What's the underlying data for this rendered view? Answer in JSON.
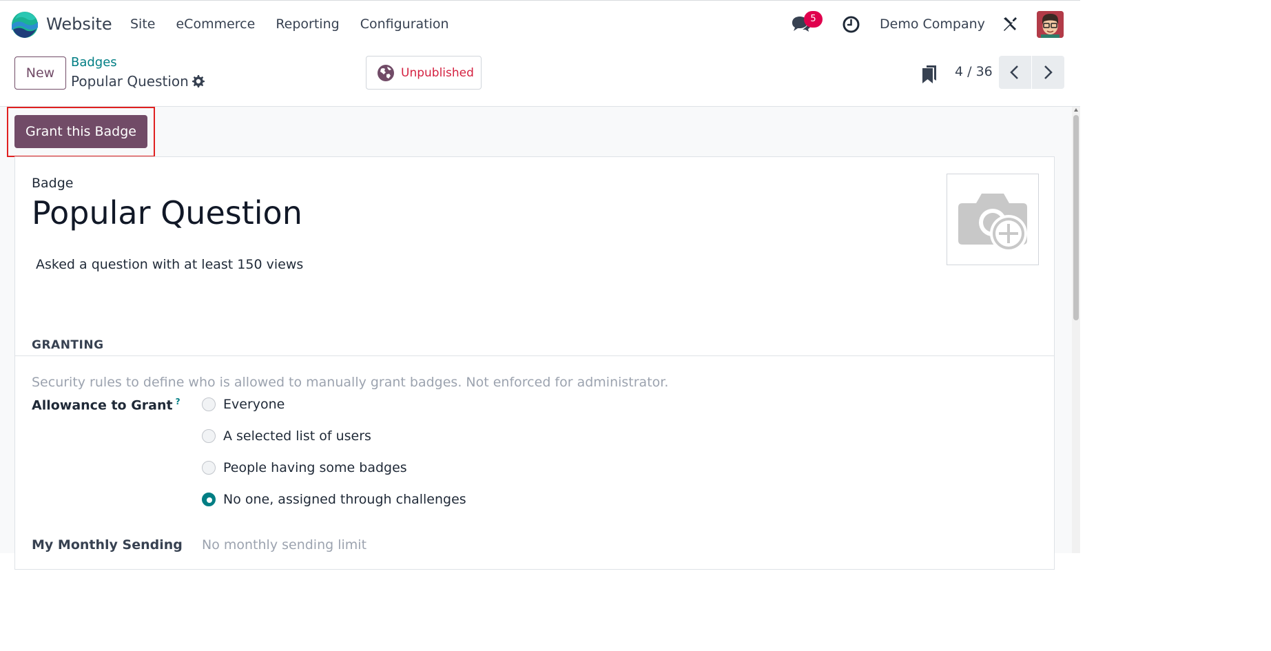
{
  "navbar": {
    "app_name": "Website",
    "menu": [
      "Site",
      "eCommerce",
      "Reporting",
      "Configuration"
    ],
    "chat_count": "5",
    "company": "Demo Company"
  },
  "control": {
    "new_label": "New",
    "breadcrumb_parent": "Badges",
    "breadcrumb_current": "Popular Question",
    "publish_status": "Unpublished",
    "pager": "4 / 36"
  },
  "form": {
    "grant_button": "Grant this Badge",
    "badge_label": "Badge",
    "name": "Popular Question",
    "description": "Asked a question with at least 150 views",
    "section_granting": "GRANTING",
    "granting_help": "Security rules to define who is allowed to manually grant badges. Not enforced for administrator.",
    "allowance_label": "Allowance to Grant",
    "allowance_help_mark": "?",
    "allowance_options": [
      {
        "label": "Everyone",
        "selected": false
      },
      {
        "label": "A selected list of users",
        "selected": false
      },
      {
        "label": "People having some badges",
        "selected": false
      },
      {
        "label": "No one, assigned through challenges",
        "selected": true
      }
    ],
    "monthly_label": "My Monthly Sending",
    "monthly_value": "No monthly sending limit"
  },
  "colors": {
    "brand": "#714b67",
    "link": "#017e84",
    "danger": "#d42140",
    "badge": "#e0004d"
  }
}
